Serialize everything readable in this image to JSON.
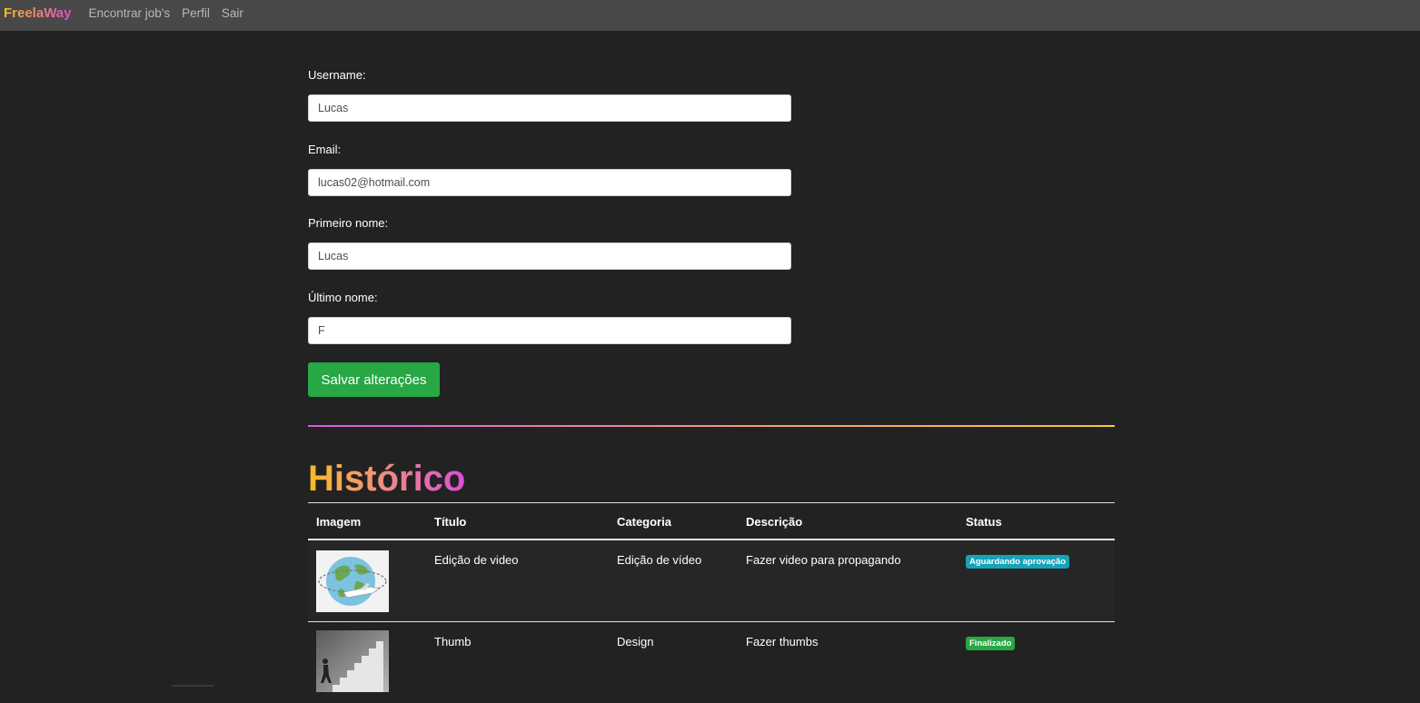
{
  "nav": {
    "brand": "FreelaWay",
    "links": [
      "Encontrar job's",
      "Perfil",
      "Sair"
    ]
  },
  "form": {
    "username": {
      "label": "Username:",
      "value": "Lucas"
    },
    "email": {
      "label": "Email:",
      "value": "lucas02@hotmail.com"
    },
    "first_name": {
      "label": "Primeiro nome:",
      "value": "Lucas"
    },
    "last_name": {
      "label": "Último nome:",
      "value": "F"
    },
    "save_label": "Salvar alterações"
  },
  "history": {
    "title": "Histórico",
    "columns": [
      "Imagem",
      "Título",
      "Categoria",
      "Descrição",
      "Status"
    ],
    "rows": [
      {
        "image": "globe-airplane-image",
        "title": "Edição de video",
        "category": "Edição de vídeo",
        "description": "Fazer video para propagando",
        "status": "Aguardando aprovação",
        "status_color": "#17a2b8"
      },
      {
        "image": "staircase-person-image",
        "title": "Thumb",
        "category": "Design",
        "description": "Fazer thumbs",
        "status": "Finalizado",
        "status_color": "#28a745"
      }
    ]
  },
  "colors": {
    "background": "#222222",
    "navbar": "#484848",
    "success": "#28a745",
    "info": "#17a2b8",
    "gradient": [
      "#f9bd26",
      "#f08a6a",
      "#d94fd8"
    ]
  }
}
